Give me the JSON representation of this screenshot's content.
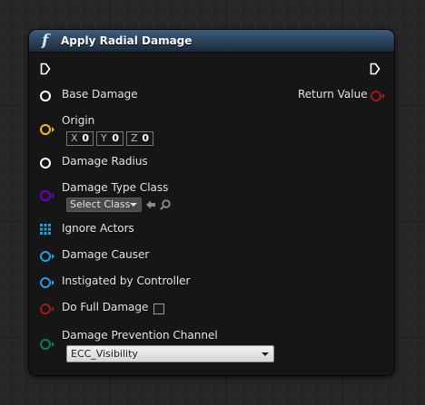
{
  "node": {
    "title": "Apply Radial Damage",
    "func_icon": "f"
  },
  "pins": {
    "base_damage": {
      "label": "Base Damage",
      "color": "#ffffff"
    },
    "return_value": {
      "label": "Return Value",
      "color": "#a31919"
    },
    "origin": {
      "label": "Origin",
      "color": "#f5b82a",
      "x_axis": "X",
      "x_value": "0",
      "y_axis": "Y",
      "y_value": "0",
      "z_axis": "Z",
      "z_value": "0"
    },
    "damage_radius": {
      "label": "Damage Radius",
      "color": "#ffffff"
    },
    "damage_type_class": {
      "label": "Damage Type Class",
      "color": "#6a00cc",
      "select_label": "Select Class"
    },
    "ignore_actors": {
      "label": "Ignore Actors",
      "color": "#1ea0e8"
    },
    "damage_causer": {
      "label": "Damage Causer",
      "color": "#1ea0e8"
    },
    "instigated_by_controller": {
      "label": "Instigated by Controller",
      "color": "#1ea0e8"
    },
    "do_full_damage": {
      "label": "Do Full Damage",
      "color": "#a31919"
    },
    "damage_prevention_channel": {
      "label": "Damage Prevention Channel",
      "color": "#0f7a5e",
      "value": "ECC_Visibility"
    }
  }
}
